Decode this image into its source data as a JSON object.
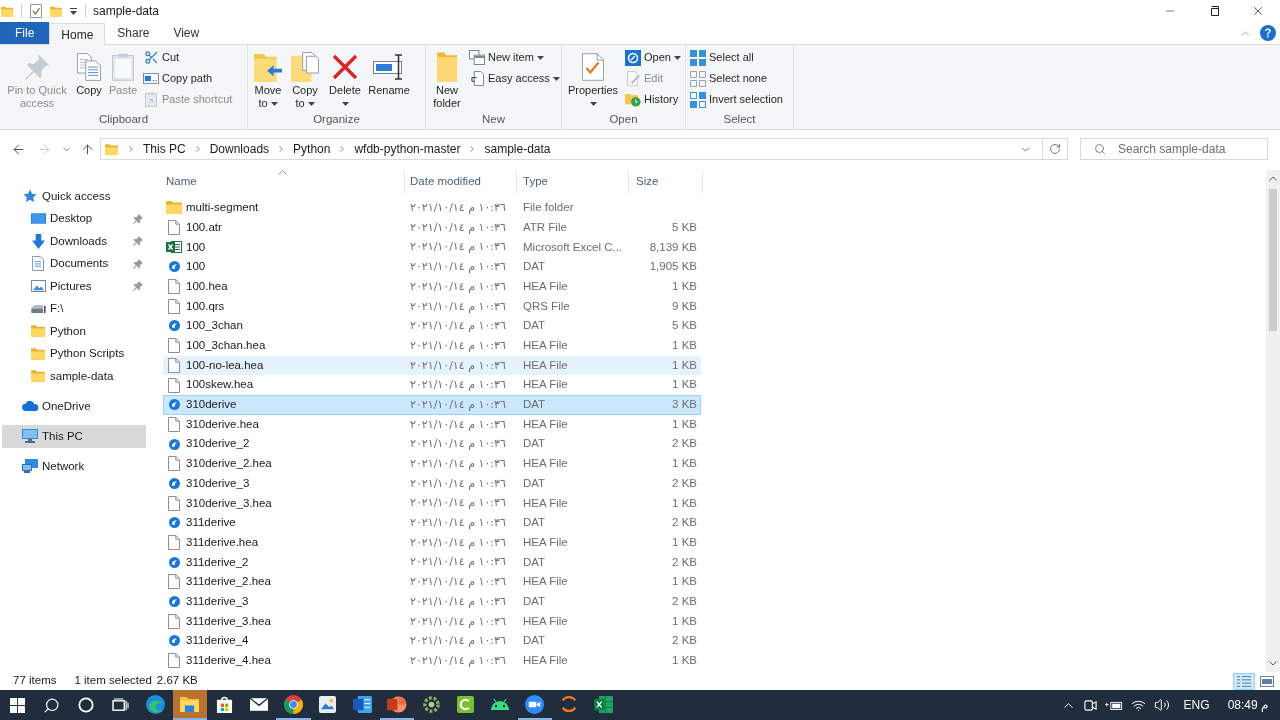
{
  "title_bar": {
    "title": "sample-data"
  },
  "ribbon_tabs": [
    {
      "label": "File",
      "kind": "menu",
      "selected": false
    },
    {
      "label": "Home",
      "kind": "tab",
      "selected": true
    },
    {
      "label": "Share",
      "kind": "tab",
      "selected": false
    },
    {
      "label": "View",
      "kind": "tab",
      "selected": false
    }
  ],
  "ribbon": {
    "groups": [
      {
        "label": "Clipboard",
        "buttons": [
          {
            "label": "Pin to Quick access",
            "disabled": true,
            "dropdown": false
          },
          {
            "label": "Copy",
            "disabled": false,
            "dropdown": false
          },
          {
            "label": "Paste",
            "disabled": true,
            "dropdown": false
          }
        ],
        "commands": [
          {
            "label": "Cut",
            "disabled": false,
            "dropdown": false
          },
          {
            "label": "Copy path",
            "disabled": false,
            "dropdown": false
          },
          {
            "label": "Paste shortcut",
            "disabled": true,
            "dropdown": false
          }
        ]
      },
      {
        "label": "Organize",
        "buttons": [
          {
            "label": "Move to",
            "disabled": false,
            "dropdown": true
          },
          {
            "label": "Copy to",
            "disabled": false,
            "dropdown": true
          },
          {
            "label": "Delete",
            "disabled": false,
            "dropdown": true
          },
          {
            "label": "Rename",
            "disabled": false,
            "dropdown": false
          }
        ]
      },
      {
        "label": "New",
        "buttons": [
          {
            "label": "New folder",
            "disabled": false,
            "dropdown": false
          }
        ],
        "commands": [
          {
            "label": "New item",
            "disabled": false,
            "dropdown": true
          },
          {
            "label": "Easy access",
            "disabled": false,
            "dropdown": true
          }
        ]
      },
      {
        "label": "Open",
        "buttons": [
          {
            "label": "Properties",
            "disabled": false,
            "dropdown": true
          }
        ],
        "commands": [
          {
            "label": "Open",
            "disabled": false,
            "dropdown": true
          },
          {
            "label": "Edit",
            "disabled": true,
            "dropdown": false
          },
          {
            "label": "History",
            "disabled": false,
            "dropdown": false
          }
        ]
      },
      {
        "label": "Select",
        "commands": [
          {
            "label": "Select all",
            "disabled": false,
            "dropdown": false
          },
          {
            "label": "Select none",
            "disabled": false,
            "dropdown": false
          },
          {
            "label": "Invert selection",
            "disabled": false,
            "dropdown": false
          }
        ]
      }
    ]
  },
  "address_bar": {
    "navigation": [
      {
        "kind": "back",
        "disabled": false
      },
      {
        "kind": "forward",
        "disabled": true
      },
      {
        "kind": "recent",
        "disabled": false
      },
      {
        "kind": "up",
        "disabled": false
      }
    ],
    "breadcrumbs": [
      "This PC",
      "Downloads",
      "Python",
      "wfdb-python-master",
      "sample-data"
    ],
    "search": {
      "placeholder": "Search sample-data"
    }
  },
  "navigation_pane": {
    "items": [
      {
        "label": "Quick access",
        "kind": "star",
        "selected": false,
        "children": [
          {
            "label": "Desktop",
            "kind": "desktop",
            "pinned": true,
            "selected": false
          },
          {
            "label": "Downloads",
            "kind": "downloads",
            "pinned": true,
            "selected": false
          },
          {
            "label": "Documents",
            "kind": "documents",
            "pinned": true,
            "selected": false
          },
          {
            "label": "Pictures",
            "kind": "pictures",
            "pinned": true,
            "selected": false
          },
          {
            "label": "F:\\",
            "kind": "drive",
            "pinned": false,
            "selected": false
          },
          {
            "label": "Python",
            "kind": "folder",
            "pinned": false,
            "selected": false
          },
          {
            "label": "Python Scripts",
            "kind": "folder",
            "pinned": false,
            "selected": false
          },
          {
            "label": "sample-data",
            "kind": "folder",
            "pinned": false,
            "selected": false
          }
        ]
      },
      {
        "label": "OneDrive",
        "kind": "cloud",
        "selected": false
      },
      {
        "label": "This PC",
        "kind": "computer",
        "selected": true
      },
      {
        "label": "Network",
        "kind": "network",
        "selected": false
      }
    ]
  },
  "file_list": {
    "columns": [
      {
        "label": "Name",
        "sorted": true
      },
      {
        "label": "Date modified",
        "sorted": false
      },
      {
        "label": "Type",
        "sorted": false
      },
      {
        "label": "Size",
        "sorted": false
      }
    ],
    "rows": [
      {
        "name": "multi-segment",
        "kind": "folder",
        "date": "٢٠٢١/١٠/١٤ م ١٠:٣٦",
        "type": "File folder",
        "selected": false,
        "hovered": false
      },
      {
        "name": "100.atr",
        "kind": "file",
        "date": "٢٠٢١/١٠/١٤ م ١٠:٣٦",
        "type": "ATR File",
        "size": "5 KB",
        "selected": false,
        "hovered": false
      },
      {
        "name": "100",
        "kind": "excel",
        "date": "٢٠٢١/١٠/١٤ م ١٠:٣٦",
        "type": "Microsoft Excel C...",
        "size": "8,139 KB",
        "selected": false,
        "hovered": false
      },
      {
        "name": "100",
        "kind": "dat",
        "date": "٢٠٢١/١٠/١٤ م ١٠:٣٦",
        "type": "DAT",
        "size": "1,905 KB",
        "selected": false,
        "hovered": false
      },
      {
        "name": "100.hea",
        "kind": "file",
        "date": "٢٠٢١/١٠/١٤ م ١٠:٣٦",
        "type": "HEA File",
        "size": "1 KB",
        "selected": false,
        "hovered": false
      },
      {
        "name": "100.qrs",
        "kind": "file",
        "date": "٢٠٢١/١٠/١٤ م ١٠:٣٦",
        "type": "QRS File",
        "size": "9 KB",
        "selected": false,
        "hovered": false
      },
      {
        "name": "100_3chan",
        "kind": "dat",
        "date": "٢٠٢١/١٠/١٤ م ١٠:٣٦",
        "type": "DAT",
        "size": "5 KB",
        "selected": false,
        "hovered": false
      },
      {
        "name": "100_3chan.hea",
        "kind": "file",
        "date": "٢٠٢١/١٠/١٤ م ١٠:٣٦",
        "type": "HEA File",
        "size": "1 KB",
        "selected": false,
        "hovered": false
      },
      {
        "name": "100-no-lea.hea",
        "kind": "file",
        "date": "٢٠٢١/١٠/١٤ م ١٠:٣٦",
        "type": "HEA File",
        "size": "1 KB",
        "selected": false,
        "hovered": true
      },
      {
        "name": "100skew.hea",
        "kind": "file",
        "date": "٢٠٢١/١٠/١٤ م ١٠:٣٦",
        "type": "HEA File",
        "size": "1 KB",
        "selected": false,
        "hovered": false
      },
      {
        "name": "310derive",
        "kind": "dat",
        "date": "٢٠٢١/١٠/١٤ م ١٠:٣٦",
        "type": "DAT",
        "size": "3 KB",
        "selected": true,
        "hovered": false
      },
      {
        "name": "310derive.hea",
        "kind": "file",
        "date": "٢٠٢١/١٠/١٤ م ١٠:٣٦",
        "type": "HEA File",
        "size": "1 KB",
        "selected": false,
        "hovered": false
      },
      {
        "name": "310derive_2",
        "kind": "dat",
        "date": "٢٠٢١/١٠/١٤ م ١٠:٣٦",
        "type": "DAT",
        "size": "2 KB",
        "selected": false,
        "hovered": false
      },
      {
        "name": "310derive_2.hea",
        "kind": "file",
        "date": "٢٠٢١/١٠/١٤ م ١٠:٣٦",
        "type": "HEA File",
        "size": "1 KB",
        "selected": false,
        "hovered": false
      },
      {
        "name": "310derive_3",
        "kind": "dat",
        "date": "٢٠٢١/١٠/١٤ م ١٠:٣٦",
        "type": "DAT",
        "size": "2 KB",
        "selected": false,
        "hovered": false
      },
      {
        "name": "310derive_3.hea",
        "kind": "file",
        "date": "٢٠٢١/١٠/١٤ م ١٠:٣٦",
        "type": "HEA File",
        "size": "1 KB",
        "selected": false,
        "hovered": false
      },
      {
        "name": "311derive",
        "kind": "dat",
        "date": "٢٠٢١/١٠/١٤ م ١٠:٣٦",
        "type": "DAT",
        "size": "2 KB",
        "selected": false,
        "hovered": false
      },
      {
        "name": "311derive.hea",
        "kind": "file",
        "date": "٢٠٢١/١٠/١٤ م ١٠:٣٦",
        "type": "HEA File",
        "size": "1 KB",
        "selected": false,
        "hovered": false
      },
      {
        "name": "311derive_2",
        "kind": "dat",
        "date": "٢٠٢١/١٠/١٤ م ١٠:٣٦",
        "type": "DAT",
        "size": "2 KB",
        "selected": false,
        "hovered": false
      },
      {
        "name": "311derive_2.hea",
        "kind": "file",
        "date": "٢٠٢١/١٠/١٤ م ١٠:٣٦",
        "type": "HEA File",
        "size": "1 KB",
        "selected": false,
        "hovered": false
      },
      {
        "name": "311derive_3",
        "kind": "dat",
        "date": "٢٠٢١/١٠/١٤ م ١٠:٣٦",
        "type": "DAT",
        "size": "2 KB",
        "selected": false,
        "hovered": false
      },
      {
        "name": "311derive_3.hea",
        "kind": "file",
        "date": "٢٠٢١/١٠/١٤ م ١٠:٣٦",
        "type": "HEA File",
        "size": "1 KB",
        "selected": false,
        "hovered": false
      },
      {
        "name": "311derive_4",
        "kind": "dat",
        "date": "٢٠٢١/١٠/١٤ م ١٠:٣٦",
        "type": "DAT",
        "size": "2 KB",
        "selected": false,
        "hovered": false
      },
      {
        "name": "311derive_4.hea",
        "kind": "file",
        "date": "٢٠٢١/١٠/١٤ م ١٠:٣٦",
        "type": "HEA File",
        "size": "1 KB",
        "selected": false,
        "hovered": false
      }
    ]
  },
  "status_bar": {
    "item_count": "77 items",
    "selection": "1 item selected",
    "selection_size": "2.67 KB",
    "views": [
      {
        "kind": "details",
        "selected": true
      },
      {
        "kind": "thumbnails",
        "selected": false
      }
    ]
  },
  "taskbar": {
    "apps": [
      {
        "kind": "swirl",
        "selected": false,
        "running": false
      },
      {
        "kind": "folder",
        "selected": true,
        "running": true
      },
      {
        "kind": "bag",
        "selected": false,
        "running": false
      },
      {
        "kind": "envelope",
        "selected": false,
        "running": false
      },
      {
        "kind": "ring",
        "selected": false,
        "running": true
      },
      {
        "kind": "picture",
        "selected": false,
        "running": false
      },
      {
        "kind": "doc",
        "selected": false,
        "running": false
      },
      {
        "kind": "slides",
        "selected": false,
        "running": true
      },
      {
        "kind": "gear",
        "selected": false,
        "running": false
      },
      {
        "kind": "tile",
        "selected": false,
        "running": false
      },
      {
        "kind": "robot",
        "selected": false,
        "running": false
      },
      {
        "kind": "camera",
        "selected": false,
        "running": true
      },
      {
        "kind": "arcs",
        "selected": false,
        "running": false
      },
      {
        "kind": "sheet",
        "selected": false,
        "running": false
      }
    ],
    "language": "ENG",
    "clock": "08:49 م"
  }
}
